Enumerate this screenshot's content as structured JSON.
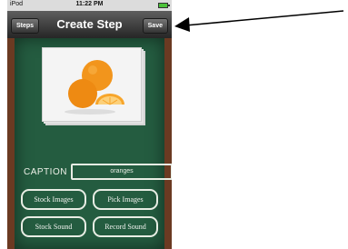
{
  "status_bar": {
    "carrier": "iPod",
    "time": "11:22 PM"
  },
  "nav": {
    "left_button": "Steps",
    "title": "Create Step",
    "right_button": "Save"
  },
  "photo": {
    "subject": "orange-image"
  },
  "caption": {
    "label": "CAPTION",
    "value": "oranges"
  },
  "buttons": {
    "stock_images": "Stock Images",
    "pick_images": "Pick Images",
    "stock_sound": "Stock Sound",
    "record_sound": "Record Sound"
  },
  "colors": {
    "board": "#245c40",
    "frame": "#6b3a22",
    "navbar": "#3a3a3a",
    "chalk": "#e8ede4"
  }
}
